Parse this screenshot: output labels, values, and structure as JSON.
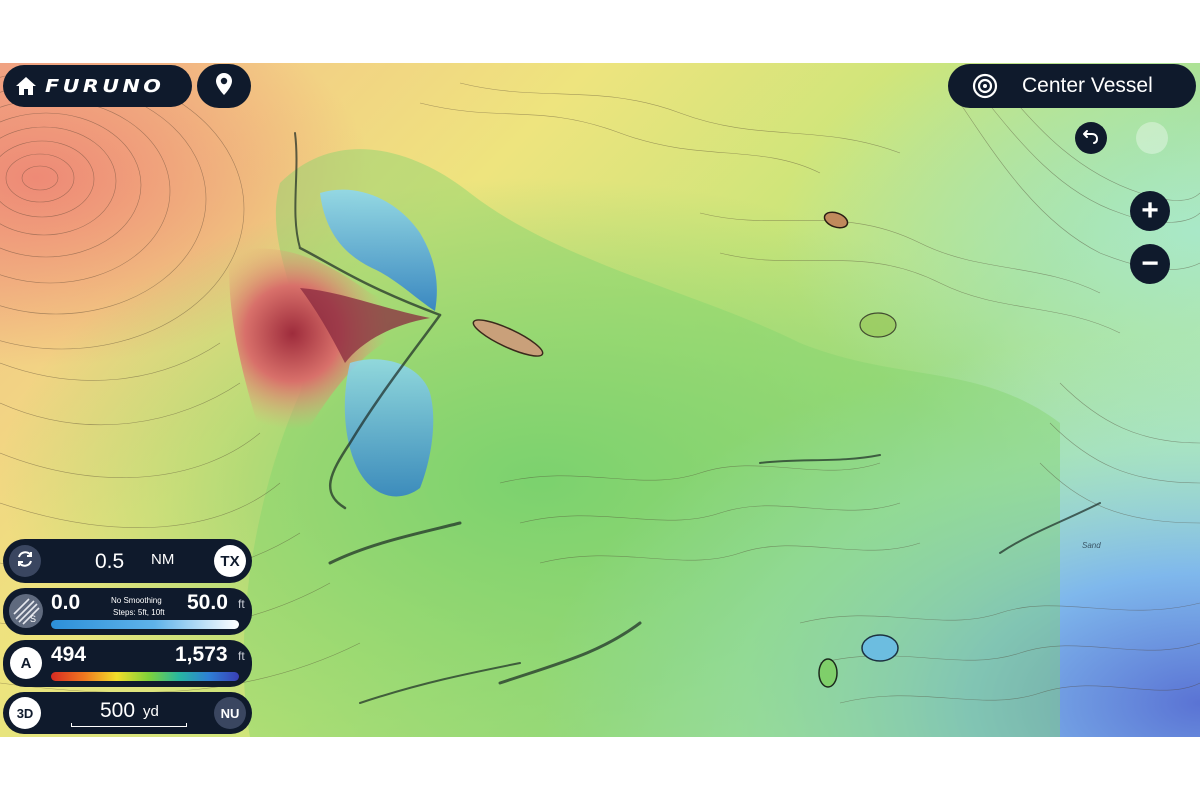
{
  "brand": {
    "logo_text": "FURUNO"
  },
  "top_right": {
    "center_label": "Center Vessel"
  },
  "zoom": {
    "plus": "+",
    "minus": "−"
  },
  "map": {
    "sand_label": "Sand"
  },
  "range_panel": {
    "value": "0.5",
    "unit": "NM",
    "tx_label": "TX"
  },
  "smoothing_panel": {
    "min": "0.0",
    "max": "50.0",
    "unit": "ft",
    "mode": "No Smoothing",
    "steps": "Steps: 5ft, 10ft",
    "icon_badge": "S"
  },
  "depth_panel": {
    "mode_badge": "A",
    "min": "494",
    "max": "1,573",
    "unit": "ft"
  },
  "view_panel": {
    "view_label": "3D",
    "scale_value": "500",
    "scale_unit": "yd",
    "orientation": "NU"
  },
  "colors": {
    "panel_bg": "#0f1a2c",
    "depth_gradient": [
      "#d72a22",
      "#f07a1f",
      "#f3df2a",
      "#7fd23a",
      "#27b6a0",
      "#2e7fd6",
      "#3a3fb5"
    ],
    "smoothing_bar": [
      "#2c8fd8",
      "#ffffff"
    ]
  }
}
